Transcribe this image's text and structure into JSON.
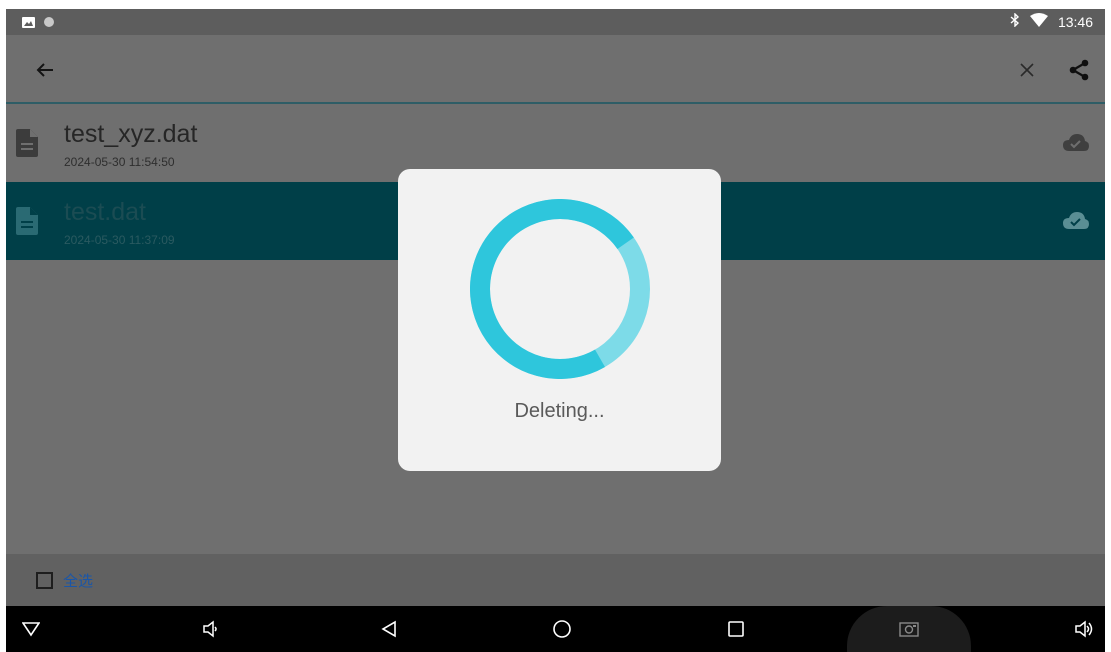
{
  "status_bar": {
    "time": "13:46",
    "icons": [
      "image-icon",
      "circle-dot-icon",
      "bluetooth-icon",
      "wifi-icon"
    ]
  },
  "app_bar": {
    "icons": [
      "back-arrow-icon",
      "close-icon",
      "share-icon"
    ]
  },
  "files": [
    {
      "name": "test_xyz.dat",
      "date": "2024-05-30 11:54:50",
      "selected": false
    },
    {
      "name": "test.dat",
      "date": "2024-05-30 11:37:09",
      "selected": true
    }
  ],
  "select_all": {
    "label": "全选",
    "checked": false
  },
  "dialog": {
    "message": "Deleting..."
  },
  "nav_bar": {
    "icons": [
      "nav-dropdown-icon",
      "volume-down-icon",
      "back-icon",
      "home-icon",
      "recents-icon",
      "screenshot-icon",
      "volume-up-icon"
    ]
  },
  "colors": {
    "accent": "#00404a",
    "spinner": "#2ec6dc",
    "link": "#1a56a8"
  }
}
